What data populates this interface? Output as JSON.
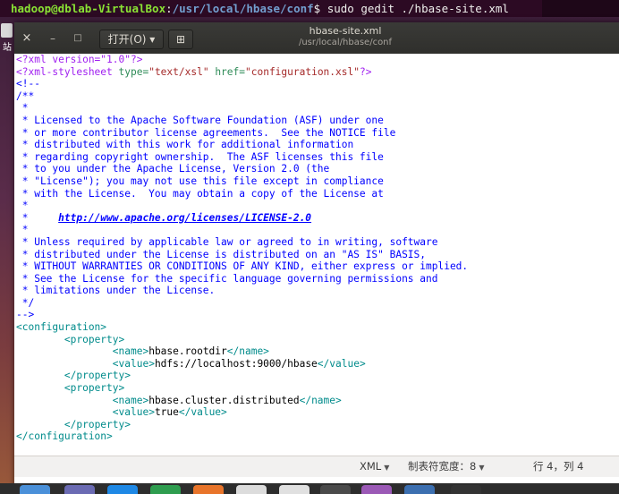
{
  "terminal": {
    "user_host": "hadoop@dblab-VirtualBox",
    "separator": ":",
    "path": "/usr/local/hbase/conf",
    "prompt": "$",
    "command": " sudo gedit ./hbase-site.xml"
  },
  "desktop": {
    "side_label": "站"
  },
  "window": {
    "close_glyph": "×",
    "minimize_glyph": "–",
    "maximize_glyph": "□",
    "open_label": "打开(O) ▾",
    "new_tab_glyph": "⊞",
    "title": "hbase-site.xml",
    "subtitle": "/usr/local/hbase/conf"
  },
  "editor": {
    "lines": [
      [
        [
          "pi",
          "<?xml version=\"1.0\"?>"
        ]
      ],
      [
        [
          "pi",
          "<?xml-stylesheet "
        ],
        [
          "attr",
          "type="
        ],
        [
          "val",
          "\"text/xsl\""
        ],
        [
          "pi",
          " "
        ],
        [
          "attr",
          "href="
        ],
        [
          "val",
          "\"configuration.xsl\""
        ],
        [
          "pi",
          "?>"
        ]
      ],
      [
        [
          "comment",
          "<!--"
        ]
      ],
      [
        [
          "comment",
          "/**"
        ]
      ],
      [
        [
          "comment",
          " *"
        ]
      ],
      [
        [
          "comment",
          " * Licensed to the Apache Software Foundation (ASF) under one"
        ]
      ],
      [
        [
          "comment",
          " * or more contributor license agreements.  See the NOTICE file"
        ]
      ],
      [
        [
          "comment",
          " * distributed with this work for additional information"
        ]
      ],
      [
        [
          "comment",
          " * regarding copyright ownership.  The ASF licenses this file"
        ]
      ],
      [
        [
          "comment",
          " * to you under the Apache License, Version 2.0 (the"
        ]
      ],
      [
        [
          "comment",
          " * \"License\"); you may not use this file except in compliance"
        ]
      ],
      [
        [
          "comment",
          " * with the License.  You may obtain a copy of the License at"
        ]
      ],
      [
        [
          "comment",
          " *"
        ]
      ],
      [
        [
          "comment",
          " *     "
        ],
        [
          "link",
          "http://www.apache.org/licenses/LICENSE-2.0"
        ]
      ],
      [
        [
          "comment",
          " *"
        ]
      ],
      [
        [
          "comment",
          " * Unless required by applicable law or agreed to in writing, software"
        ]
      ],
      [
        [
          "comment",
          " * distributed under the License is distributed on an \"AS IS\" BASIS,"
        ]
      ],
      [
        [
          "comment",
          " * WITHOUT WARRANTIES OR CONDITIONS OF ANY KIND, either express or implied."
        ]
      ],
      [
        [
          "comment",
          " * See the License for the specific language governing permissions and"
        ]
      ],
      [
        [
          "comment",
          " * limitations under the License."
        ]
      ],
      [
        [
          "comment",
          " */"
        ]
      ],
      [
        [
          "comment",
          "-->"
        ]
      ],
      [
        [
          "tag",
          "<configuration>"
        ]
      ],
      [
        [
          "text",
          "        "
        ],
        [
          "tag",
          "<property>"
        ]
      ],
      [
        [
          "text",
          "                "
        ],
        [
          "tag",
          "<name>"
        ],
        [
          "text",
          "hbase.rootdir"
        ],
        [
          "tag",
          "</name>"
        ]
      ],
      [
        [
          "text",
          "                "
        ],
        [
          "tag",
          "<value>"
        ],
        [
          "text",
          "hdfs://localhost:9000/hbase"
        ],
        [
          "tag",
          "</value>"
        ]
      ],
      [
        [
          "text",
          "        "
        ],
        [
          "tag",
          "</property>"
        ]
      ],
      [
        [
          "text",
          "        "
        ],
        [
          "tag",
          "<property>"
        ]
      ],
      [
        [
          "text",
          "                "
        ],
        [
          "tag",
          "<name>"
        ],
        [
          "text",
          "hbase.cluster.distributed"
        ],
        [
          "tag",
          "</name>"
        ]
      ],
      [
        [
          "text",
          "                "
        ],
        [
          "tag",
          "<value>"
        ],
        [
          "text",
          "true"
        ],
        [
          "tag",
          "</value>"
        ]
      ],
      [
        [
          "text",
          "        "
        ],
        [
          "tag",
          "</property>"
        ]
      ],
      [
        [
          "tag",
          "</configuration>"
        ]
      ]
    ]
  },
  "statusbar": {
    "language": "XML",
    "tab_width": "制表符宽度：8",
    "position": "行 4，列 4",
    "dropdown_glyph": "▼"
  },
  "taskbar": {
    "icons": [
      "app-icon-1",
      "app-icon-2",
      "app-icon-3",
      "app-icon-4",
      "app-icon-5",
      "app-icon-6",
      "app-icon-7",
      "app-icon-8",
      "app-icon-9",
      "app-icon-10",
      "app-icon-11"
    ]
  }
}
